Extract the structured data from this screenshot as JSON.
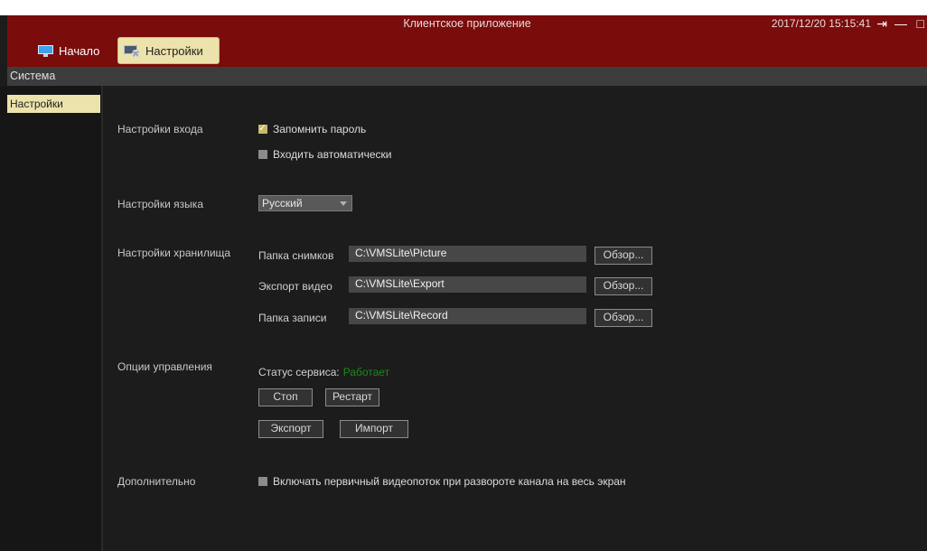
{
  "window": {
    "title": "Клиентское приложение",
    "datetime": "2017/12/20 15:15:41",
    "logout_glyph": "⇥",
    "minimize_glyph": "—",
    "maximize_glyph": "□"
  },
  "nav": {
    "home_label": "Начало",
    "settings_label": "Настройки"
  },
  "system_bar": {
    "label": "Система"
  },
  "sidebar": {
    "items": [
      {
        "label": "Настройки",
        "active": true
      }
    ]
  },
  "login": {
    "section": "Настройки входа",
    "remember_password": "Запомнить пароль",
    "remember_password_checked": true,
    "auto_login": "Входить автоматически",
    "auto_login_checked": false
  },
  "language": {
    "section": "Настройки языка",
    "selected": "Русский"
  },
  "storage": {
    "section": "Настройки хранилища",
    "rows": [
      {
        "label": "Папка снимков",
        "path": "C:\\VMSLite\\Picture",
        "button": "Обзор..."
      },
      {
        "label": "Экспорт видео",
        "path": "C:\\VMSLite\\Export",
        "button": "Обзор..."
      },
      {
        "label": "Папка записи",
        "path": "C:\\VMSLite\\Record",
        "button": "Обзор..."
      }
    ]
  },
  "control": {
    "section": "Опции управления",
    "status_label": "Статус сервиса:",
    "status_value": "Работает",
    "status_color": "#1a8a1a",
    "stop": "Стоп",
    "restart": "Рестарт",
    "export": "Экспорт",
    "import": "Импорт"
  },
  "advanced": {
    "section": "Дополнительно",
    "main_stream": "Включать первичный видеопоток при развороте канала на весь экран",
    "main_stream_checked": false
  },
  "colors": {
    "title_bar": "#7a0c0c",
    "accent": "#ece2ab",
    "background": "#1c1c1c"
  }
}
